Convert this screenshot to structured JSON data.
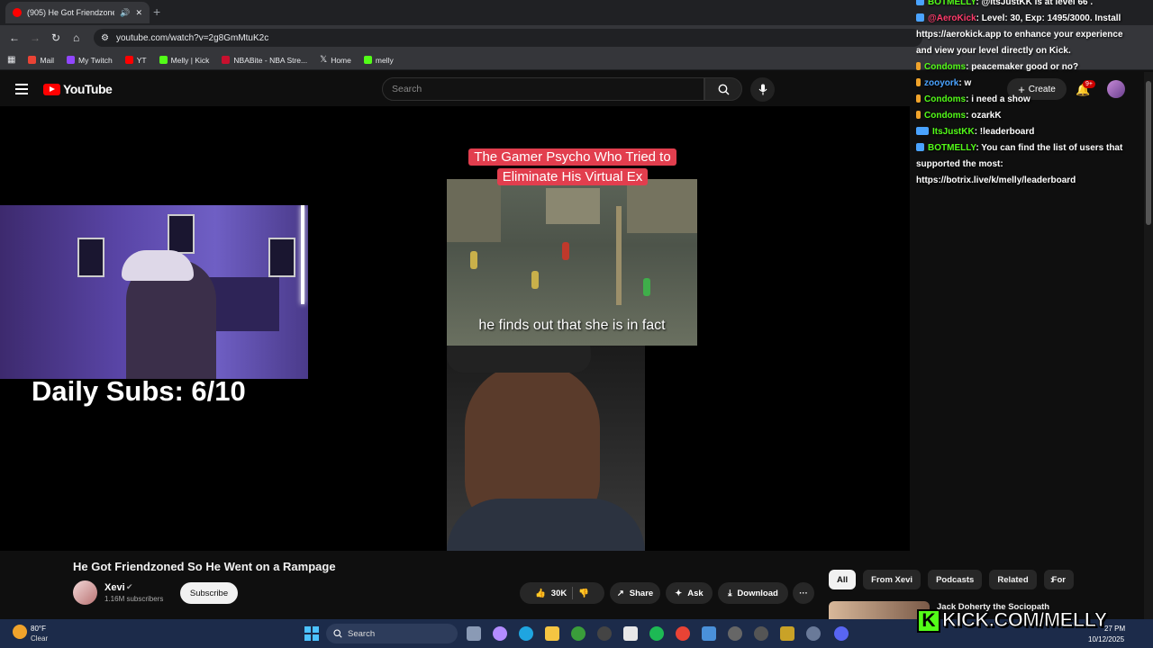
{
  "browser": {
    "tab_title": "(905) He Got Friendzoned S",
    "url": "youtube.com/watch?v=2g8GmMtuK2c",
    "new_tab": "+",
    "close": "✕",
    "audio_icon": "speaker-icon",
    "bookmarks": [
      {
        "label": "Mail",
        "color": "#ea4335"
      },
      {
        "label": "My Twitch",
        "color": "#9146ff"
      },
      {
        "label": "YT",
        "color": "#ff0000"
      },
      {
        "label": "Melly | Kick",
        "color": "#53fc18"
      },
      {
        "label": "NBABite - NBA Stre...",
        "color": "#c8102e"
      },
      {
        "label": "Home",
        "color": "#ffffff"
      },
      {
        "label": "melly",
        "color": "#53fc18"
      }
    ]
  },
  "youtube": {
    "logo_text": "YouTube",
    "search_placeholder": "Search",
    "create_label": "Create",
    "notif_badge": "9+"
  },
  "video": {
    "banner_title": "The Gamer Psycho Who Tried to Eliminate His Virtual Ex",
    "caption": "he finds out that she is in fact"
  },
  "overlay": {
    "daily_subs": "Daily Subs: 6/10",
    "kick_url": "KICK.COM/MELLY",
    "kick_logo": "K"
  },
  "watch": {
    "title": "He Got Friendzoned So He Went on a Rampage",
    "channel": "Xevi",
    "subscribers": "1.16M subscribers",
    "subscribe": "Subscribe",
    "likes": "30K",
    "share": "Share",
    "ask": "Ask",
    "download": "Download",
    "more": "···"
  },
  "chips": [
    "All",
    "From Xevi",
    "Podcasts",
    "Related",
    "For"
  ],
  "recommendation": {
    "title": "Jack Doherty the Sociopath"
  },
  "chat": [
    {
      "user": "BOTMELLY",
      "color": "#53fc18",
      "text": ": @ItsJustKK is at level 66 ."
    },
    {
      "user": "@AeroKick",
      "color": "#ff3b6b",
      "text": ": Level: 30, Exp: 1495/3000. Install https://aerokick.app to enhance your experience and view your level directly on Kick."
    },
    {
      "user": "Condoms",
      "color": "#53fc18",
      "text": ": peacemaker good or no?"
    },
    {
      "user": "zooyork",
      "color": "#4aa3ff",
      "text": ": w"
    },
    {
      "user": "Condoms",
      "color": "#53fc18",
      "text": ": i need a show"
    },
    {
      "user": "Condoms",
      "color": "#53fc18",
      "text": ": ozarkK"
    },
    {
      "user": "ItsJustKK",
      "color": "#53fc18",
      "text": ": !leaderboard"
    },
    {
      "user": "BOTMELLY",
      "color": "#53fc18",
      "text": ": You can find the list of users that supported the most: https://botrix.live/k/melly/leaderboard"
    }
  ],
  "taskbar": {
    "temp": "80°F",
    "condition": "Clear",
    "search": "Search",
    "time": "27 PM",
    "date": "10/12/2025"
  }
}
